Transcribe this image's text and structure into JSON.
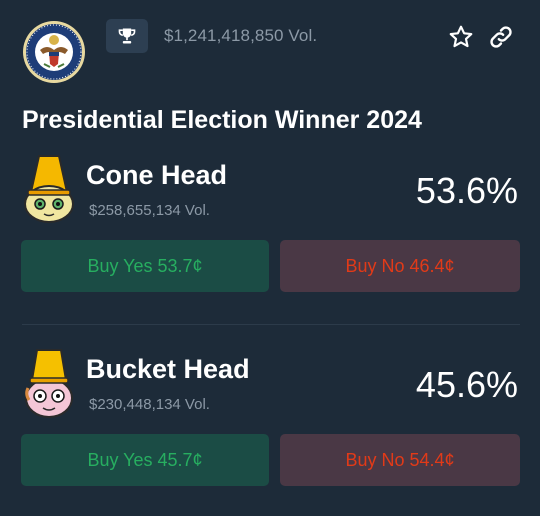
{
  "header": {
    "volume": "$1,241,418,850 Vol.",
    "seal_icon": "presidential-seal",
    "trophy_icon": "trophy-icon",
    "star_icon": "star-icon",
    "link_icon": "link-icon"
  },
  "title": "Presidential Election Winner 2024",
  "markets": [
    {
      "name": "Cone Head",
      "volume": "$258,655,134 Vol.",
      "percent": "53.6%",
      "buy_yes": "Buy Yes 53.7¢",
      "buy_no": "Buy No 46.4¢"
    },
    {
      "name": "Bucket Head",
      "volume": "$230,448,134 Vol.",
      "percent": "45.6%",
      "buy_yes": "Buy Yes 45.7¢",
      "buy_no": "Buy No 54.4¢"
    }
  ],
  "colors": {
    "background": "#1d2b39",
    "yes_bg": "#1b4c45",
    "yes_text": "#27ae60",
    "no_bg": "#4a3845",
    "no_text": "#e13a18",
    "muted_text": "#8c99a6"
  }
}
